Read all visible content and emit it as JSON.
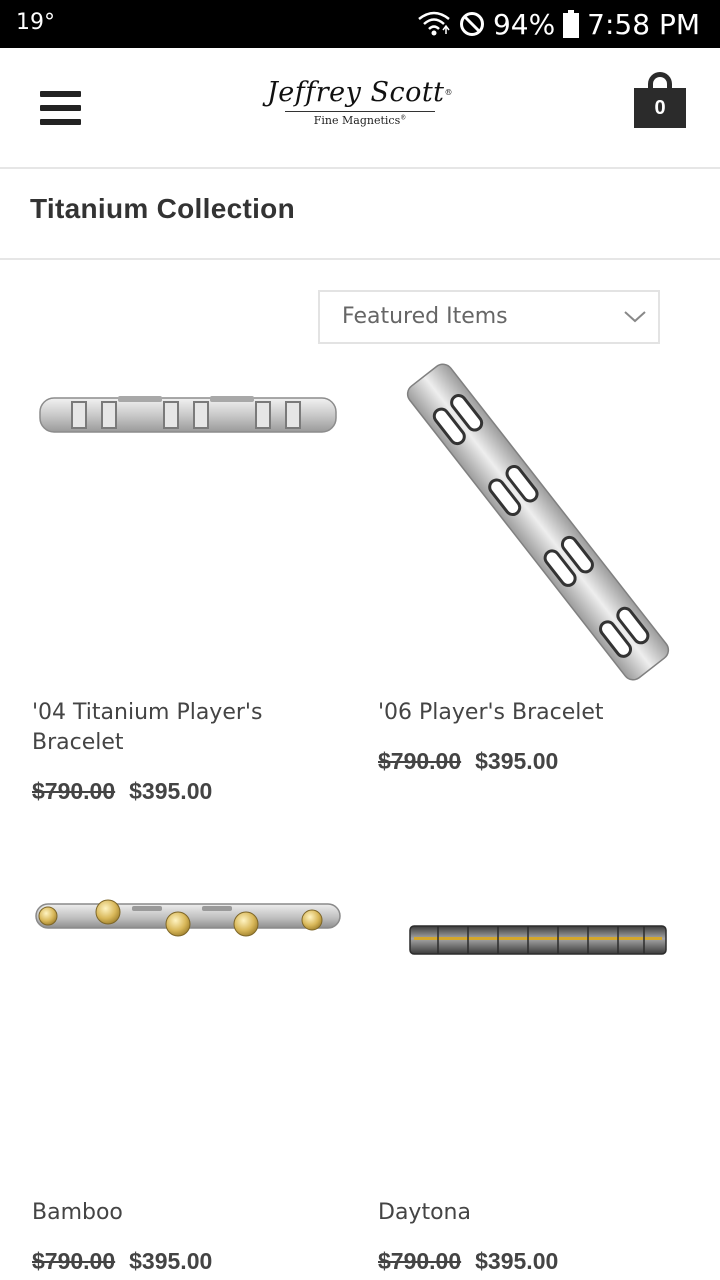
{
  "status_bar": {
    "temperature": "19°",
    "battery": "94%",
    "time": "7:58 PM"
  },
  "header": {
    "logo_script": "Jeffrey Scott",
    "logo_sub": "Fine Magnetics",
    "cart_count": "0"
  },
  "page": {
    "title": "Titanium Collection"
  },
  "sort": {
    "selected": "Featured Items"
  },
  "products": [
    {
      "name": "'04 Titanium Player's Bracelet",
      "old_price": "$790.00",
      "price": "$395.00"
    },
    {
      "name": "'06 Player's Bracelet",
      "old_price": "$790.00",
      "price": "$395.00"
    },
    {
      "name": "Bamboo",
      "old_price": "$790.00",
      "price": "$395.00"
    },
    {
      "name": "Daytona",
      "old_price": "$790.00",
      "price": "$395.00"
    }
  ],
  "colors": {
    "status_bar_bg": "#000000",
    "cart_bg": "#2b2b2b",
    "text": "#444444",
    "divider": "#e6e6e6"
  },
  "icons": [
    "wifi-icon",
    "do-not-disturb-icon",
    "battery-icon",
    "hamburger-menu-icon",
    "cart-bag-icon",
    "chevron-down-icon"
  ]
}
